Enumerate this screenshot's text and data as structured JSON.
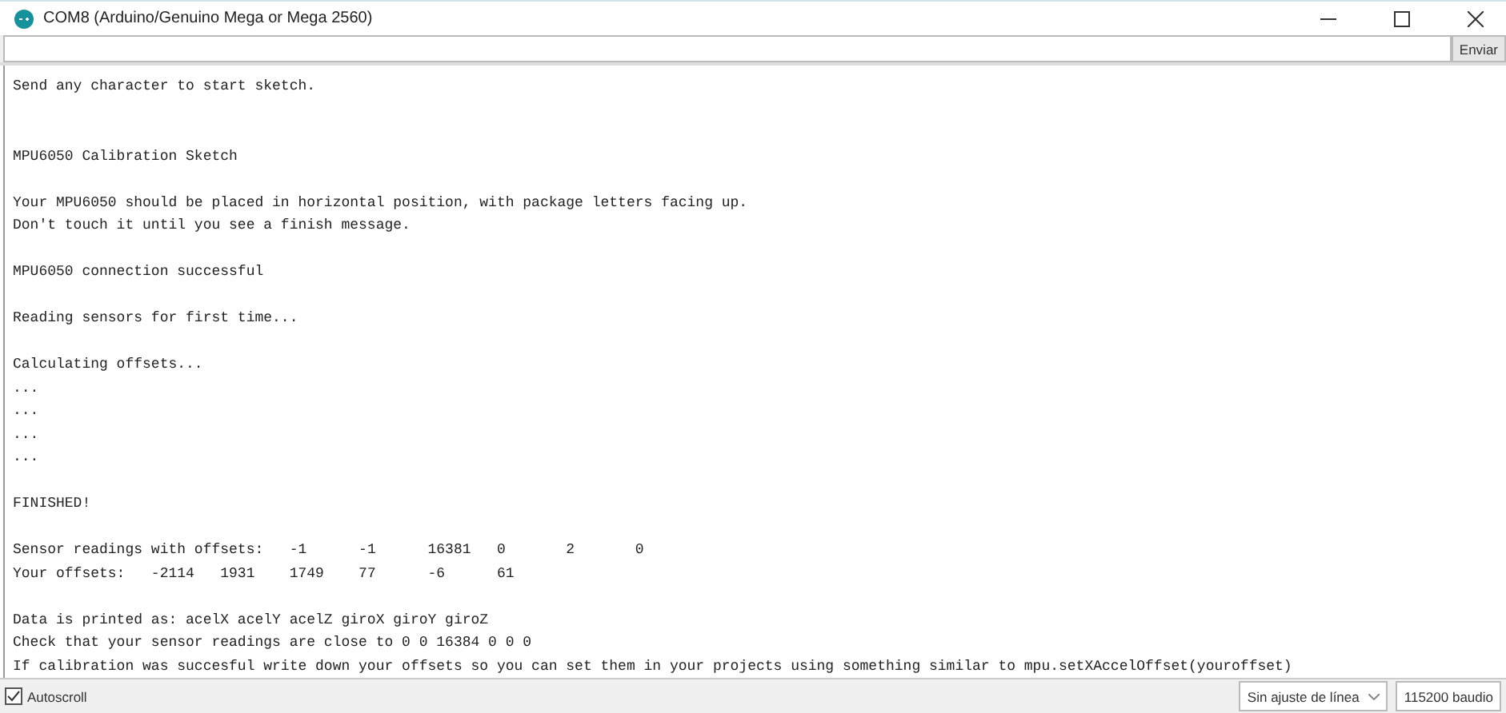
{
  "window": {
    "title": "COM8 (Arduino/Genuino Mega or Mega 2560)"
  },
  "send": {
    "button": "Enviar"
  },
  "output": [
    [
      "Send any character to start sketch."
    ],
    [
      "MPU6050 Calibration Sketch"
    ],
    [
      "Your MPU6050 should be placed in horizontal position, with package letters facing up.",
      "Don't touch it until you see a finish message."
    ],
    [
      "MPU6050 connection successful"
    ],
    [
      "Reading sensors for first time..."
    ],
    [
      "Calculating offsets...",
      "...",
      "...",
      "...",
      "..."
    ],
    [
      "FINISHED!"
    ],
    [
      "Sensor readings with offsets:\t-1\t-1\t16381\t0\t2\t0",
      "Your offsets:\t-2114\t1931\t1749\t77\t-6\t61"
    ],
    [
      "Data is printed as: acelX acelY acelZ giroX giroY giroZ",
      "Check that your sensor readings are close to 0 0 16384 0 0 0",
      "If calibration was succesful write down your offsets so you can set them in your projects using something similar to mpu.setXAccelOffset(youroffset)"
    ]
  ],
  "status_bar": {
    "autoscroll": {
      "label": "Autoscroll",
      "checked": true
    },
    "line_ending": "Sin ajuste de línea",
    "baud": "115200 baudio"
  }
}
